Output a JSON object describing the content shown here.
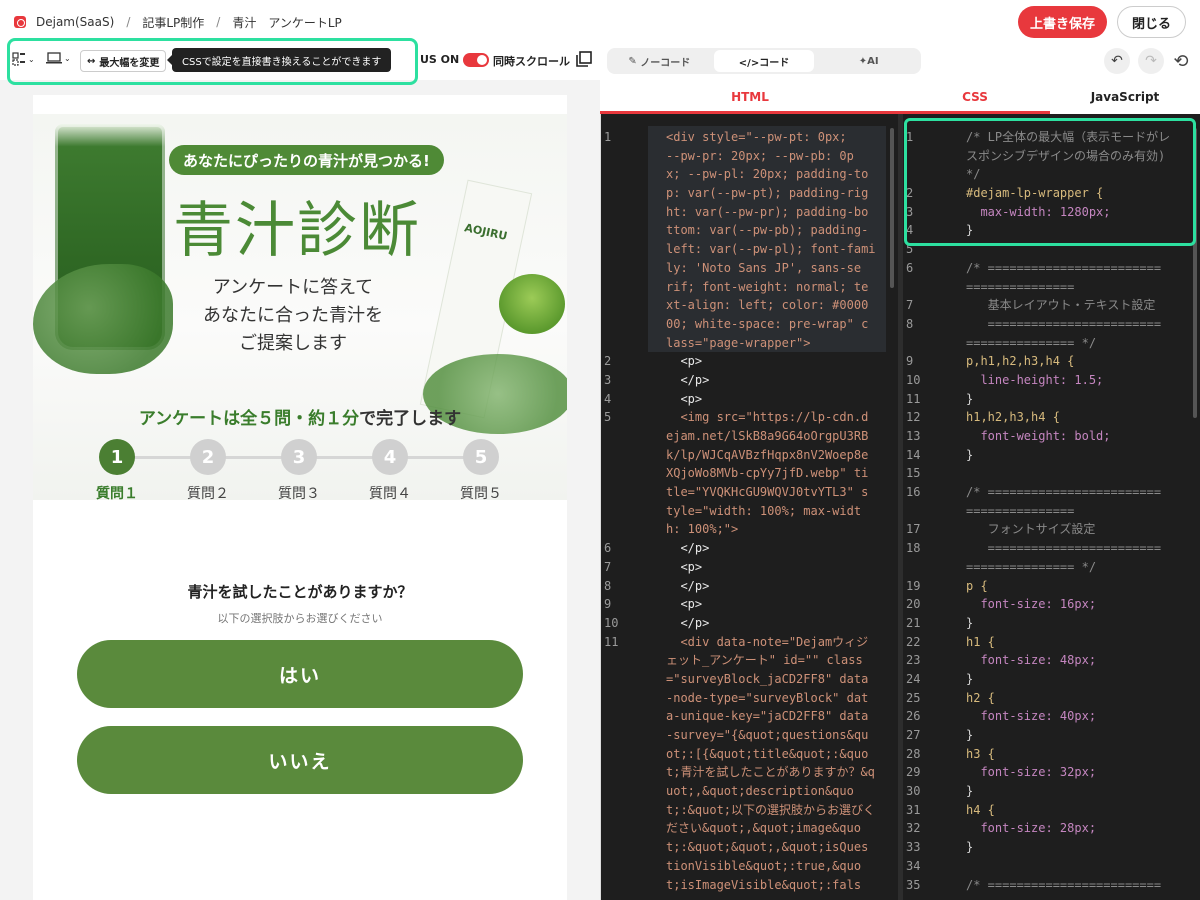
{
  "breadcrumb": [
    "Dejam(SaaS)",
    "記事LP制作",
    "青汁　アンケートLP"
  ],
  "header": {
    "save_label": "上書き保存",
    "close_label": "閉じる"
  },
  "toolbar": {
    "maxwidth_label": "最大幅を変更",
    "tooltip": "CSSで設定を直接書き換えることができます",
    "status_label": "US ON",
    "sync_label": "同時スクロール"
  },
  "editor": {
    "modes": [
      "ノーコード",
      "</>コード",
      "AI"
    ],
    "active_mode": "</>コード",
    "langs": [
      "HTML",
      "CSS",
      "JavaScript"
    ],
    "html_lines": [
      {
        "n": "1",
        "t": "<div style=\"--pw-pt: 0px;"
      },
      {
        "n": "",
        "t": "--pw-pr: 20px; --pw-pb: 0p"
      },
      {
        "n": "",
        "t": "x; --pw-pl: 20px; padding-to"
      },
      {
        "n": "",
        "t": "p: var(--pw-pt); padding-rig"
      },
      {
        "n": "",
        "t": "ht: var(--pw-pr); padding-bo"
      },
      {
        "n": "",
        "t": "ttom: var(--pw-pb); padding-"
      },
      {
        "n": "",
        "t": "left: var(--pw-pl); font-fami"
      },
      {
        "n": "",
        "t": "ly: 'Noto Sans JP', sans-se"
      },
      {
        "n": "",
        "t": "rif; font-weight: normal; te"
      },
      {
        "n": "",
        "t": "xt-align: left; color: #0000"
      },
      {
        "n": "",
        "t": "00; white-space: pre-wrap\" c"
      },
      {
        "n": "",
        "t": "lass=\"page-wrapper\">"
      },
      {
        "n": "2",
        "t": "  <p>"
      },
      {
        "n": "3",
        "t": "  </p>"
      },
      {
        "n": "4",
        "t": "  <p>"
      },
      {
        "n": "5",
        "t": "  <img src=\"https://lp-cdn.d"
      },
      {
        "n": "",
        "t": "ejam.net/lSkB8a9G64oOrgpU3RB"
      },
      {
        "n": "",
        "t": "k/lp/WJCqAVBzfHqpx8nV2Woep8e"
      },
      {
        "n": "",
        "t": "XQjoWo8MVb-cpYy7jfD.webp\" ti"
      },
      {
        "n": "",
        "t": "tle=\"YVQKHcGU9WQVJ0tvYTL3\" s"
      },
      {
        "n": "",
        "t": "tyle=\"width: 100%; max-widt"
      },
      {
        "n": "",
        "t": "h: 100%;\">"
      },
      {
        "n": "6",
        "t": "  </p>"
      },
      {
        "n": "7",
        "t": "  <p>"
      },
      {
        "n": "8",
        "t": "  </p>"
      },
      {
        "n": "9",
        "t": "  <p>"
      },
      {
        "n": "10",
        "t": "  </p>"
      },
      {
        "n": "11",
        "t": "  <div data-note=\"Dejamウィジ"
      },
      {
        "n": "",
        "t": "ェット_アンケート\" id=\"\" class"
      },
      {
        "n": "",
        "t": "=\"surveyBlock_jaCD2FF8\" data"
      },
      {
        "n": "",
        "t": "-node-type=\"surveyBlock\" dat"
      },
      {
        "n": "",
        "t": "a-unique-key=\"jaCD2FF8\" data"
      },
      {
        "n": "",
        "t": "-survey=\"{&quot;questions&qu"
      },
      {
        "n": "",
        "t": "ot;:[{&quot;title&quot;:&quo"
      },
      {
        "n": "",
        "t": "t;青汁を試したことがありますか？&q"
      },
      {
        "n": "",
        "t": "uot;,&quot;description&quo"
      },
      {
        "n": "",
        "t": "t;:&quot;以下の選択肢からお選びく"
      },
      {
        "n": "",
        "t": "ださい&quot;,&quot;image&quo"
      },
      {
        "n": "",
        "t": "t;:&quot;&quot;,&quot;isQues"
      },
      {
        "n": "",
        "t": "tionVisible&quot;:true,&quo"
      },
      {
        "n": "",
        "t": "t;isImageVisible&quot;:fals"
      }
    ],
    "css_lines": [
      {
        "n": "1",
        "t": "/* LP全体の最大幅（表示モードがレ",
        "k": "com"
      },
      {
        "n": "",
        "t": "スポンシブデザインの場合のみ有効)",
        "k": "com"
      },
      {
        "n": "",
        "t": "*/",
        "k": "com"
      },
      {
        "n": "2",
        "t": "#dejam-lp-wrapper {",
        "k": "sel"
      },
      {
        "n": "3",
        "t": "  max-width: 1280px;",
        "k": "prop"
      },
      {
        "n": "4",
        "t": "}",
        "k": "plain"
      },
      {
        "n": "5",
        "t": "",
        "k": "plain"
      },
      {
        "n": "6",
        "t": "/* ========================",
        "k": "com"
      },
      {
        "n": "",
        "t": "===============",
        "k": "com"
      },
      {
        "n": "7",
        "t": "   基本レイアウト・テキスト設定",
        "k": "com"
      },
      {
        "n": "8",
        "t": "   ========================",
        "k": "com"
      },
      {
        "n": "",
        "t": "=============== */",
        "k": "com"
      },
      {
        "n": "9",
        "t": "p,h1,h2,h3,h4 {",
        "k": "sel"
      },
      {
        "n": "10",
        "t": "  line-height: 1.5;",
        "k": "prop"
      },
      {
        "n": "11",
        "t": "}",
        "k": "plain"
      },
      {
        "n": "12",
        "t": "h1,h2,h3,h4 {",
        "k": "sel"
      },
      {
        "n": "13",
        "t": "  font-weight: bold;",
        "k": "prop"
      },
      {
        "n": "14",
        "t": "}",
        "k": "plain"
      },
      {
        "n": "15",
        "t": "",
        "k": "plain"
      },
      {
        "n": "16",
        "t": "/* ========================",
        "k": "com"
      },
      {
        "n": "",
        "t": "===============",
        "k": "com"
      },
      {
        "n": "17",
        "t": "   フォントサイズ設定",
        "k": "com"
      },
      {
        "n": "18",
        "t": "   ========================",
        "k": "com"
      },
      {
        "n": "",
        "t": "=============== */",
        "k": "com"
      },
      {
        "n": "19",
        "t": "p {",
        "k": "sel"
      },
      {
        "n": "20",
        "t": "  font-size: 16px;",
        "k": "prop"
      },
      {
        "n": "21",
        "t": "}",
        "k": "plain"
      },
      {
        "n": "22",
        "t": "h1 {",
        "k": "sel"
      },
      {
        "n": "23",
        "t": "  font-size: 48px;",
        "k": "prop"
      },
      {
        "n": "24",
        "t": "}",
        "k": "plain"
      },
      {
        "n": "25",
        "t": "h2 {",
        "k": "sel"
      },
      {
        "n": "26",
        "t": "  font-size: 40px;",
        "k": "prop"
      },
      {
        "n": "27",
        "t": "}",
        "k": "plain"
      },
      {
        "n": "28",
        "t": "h3 {",
        "k": "sel"
      },
      {
        "n": "29",
        "t": "  font-size: 32px;",
        "k": "prop"
      },
      {
        "n": "30",
        "t": "}",
        "k": "plain"
      },
      {
        "n": "31",
        "t": "h4 {",
        "k": "sel"
      },
      {
        "n": "32",
        "t": "  font-size: 28px;",
        "k": "prop"
      },
      {
        "n": "33",
        "t": "}",
        "k": "plain"
      },
      {
        "n": "34",
        "t": "",
        "k": "plain"
      },
      {
        "n": "35",
        "t": "/* ========================",
        "k": "com"
      }
    ]
  },
  "preview": {
    "badge": "あなたにぴったりの青汁が見つかる!",
    "title": "青汁診断",
    "subtitle": "アンケートに答えて\nあなたに合った青汁を\nご提案します",
    "product_text": "AOJIRU",
    "survey_note_green": "アンケートは全５問・約１分",
    "survey_note_rest": "で完了します",
    "steps": [
      {
        "num": "1",
        "label": "質問１",
        "active": true
      },
      {
        "num": "2",
        "label": "質問２",
        "active": false
      },
      {
        "num": "3",
        "label": "質問３",
        "active": false
      },
      {
        "num": "4",
        "label": "質問４",
        "active": false
      },
      {
        "num": "5",
        "label": "質問５",
        "active": false
      }
    ],
    "question": "青汁を試したことがありますか？",
    "question_desc": "以下の選択肢からお選びください",
    "answers": [
      "はい",
      "いいえ"
    ]
  },
  "colors": {
    "accent": "#e8383d",
    "brand_green": "#4b8a36",
    "highlight": "#2de0a0"
  }
}
